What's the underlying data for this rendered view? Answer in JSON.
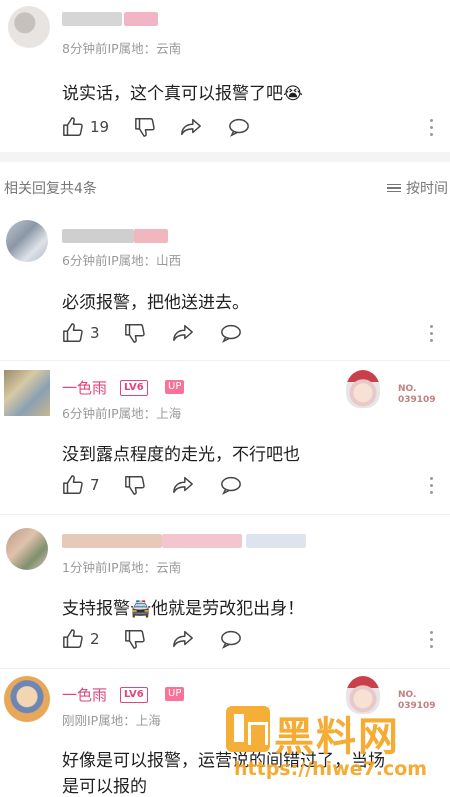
{
  "top_comment": {
    "meta": "8分钟前IP属地：云南",
    "text": "说实话，这个真可以报警了吧",
    "emoji": "😭",
    "likes": "19"
  },
  "replies_header": {
    "count_label": "相关回复共4条",
    "sort_label": "按时间"
  },
  "replies": [
    {
      "meta": "6分钟前IP属地：山西",
      "text": "必须报警，把他送进去。",
      "likes": "3"
    },
    {
      "name": "一色雨",
      "level": "LV6",
      "up": "UP",
      "meta": "6分钟前IP属地：上海",
      "text": "没到露点程度的走光，不行吧也",
      "likes": "7",
      "badge_no": "NO.",
      "badge_id": "039109"
    },
    {
      "meta": "1分钟前IP属地：云南",
      "text_a": "支持报警",
      "emoji": "🚔",
      "text_b": "他就是劳改犯出身！",
      "likes": "2"
    },
    {
      "name": "一色雨",
      "level": "LV6",
      "up": "UP",
      "meta": "刚刚IP属地：上海",
      "text_line1": "好像是可以报警，运营说的间错过了，当场",
      "text_line2": "是可以报的",
      "badge_no": "NO.",
      "badge_id": "039109"
    }
  ],
  "watermark": {
    "brand": "黑料网",
    "url": "https://hiwe7.com"
  },
  "colors": {
    "accent": "#e0457b",
    "up_bg": "#fb7299",
    "watermark": "#f5a623"
  }
}
